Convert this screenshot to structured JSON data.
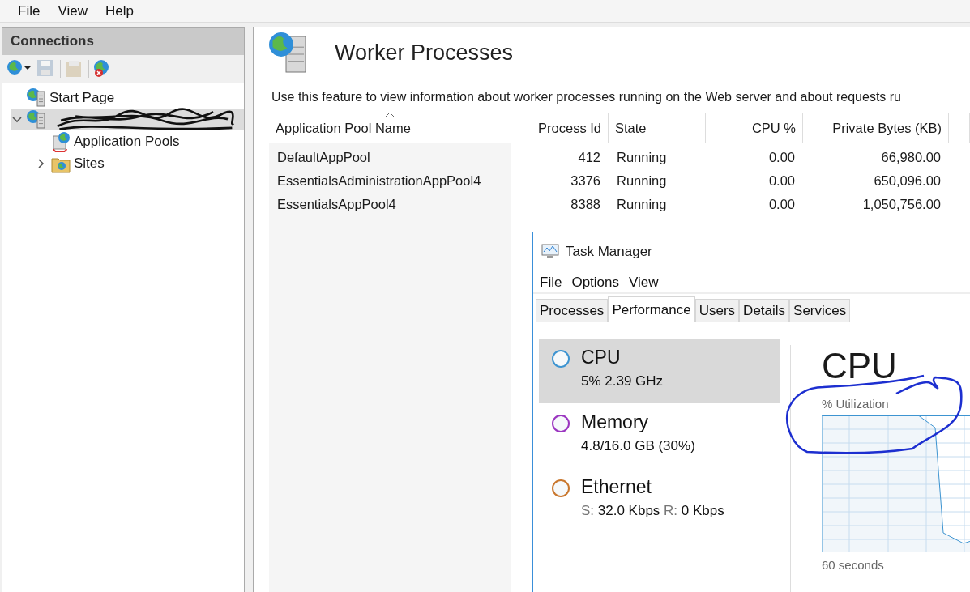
{
  "menu_bar": [
    "File",
    "View",
    "Help"
  ],
  "connections": {
    "title": "Connections",
    "toolbar": [
      {
        "disabled": false
      },
      {
        "disabled": true
      },
      {
        "disabled": true
      },
      {
        "disabled": false
      }
    ],
    "tree": [
      {
        "label": "Start Page",
        "selected": false
      },
      {
        "kind": "redacted",
        "selected": true,
        "expanded": true,
        "children": [
          {
            "label": "Application Pools",
            "selected": false
          },
          {
            "label": "Sites",
            "selected": false,
            "expanded": false
          }
        ]
      }
    ]
  },
  "feature": {
    "title": "Worker Processes",
    "description": "Use this feature to view information about worker processes running on the Web server and about requests ru",
    "table": {
      "columns": [
        {
          "label": "Application Pool Name",
          "sorted": true
        },
        {
          "label": "Process Id",
          "sorted": false
        },
        {
          "label": "State",
          "sorted": false
        },
        {
          "label": "CPU %",
          "sorted": false
        },
        {
          "label": "Private Bytes (KB)",
          "sorted": false
        }
      ],
      "rows": [
        [
          "DefaultAppPool",
          "412",
          "Running",
          "0.00",
          "66,980.00"
        ],
        [
          "EssentialsAdministrationAppPool4",
          "3376",
          "Running",
          "0.00",
          "650,096.00"
        ],
        [
          "EssentialsAppPool4",
          "8388",
          "Running",
          "0.00",
          "1,050,756.00"
        ]
      ]
    }
  },
  "task_manager": {
    "title": "Task Manager",
    "menu": [
      "File",
      "Options",
      "View"
    ],
    "tabs": [
      {
        "label": "Processes",
        "selected": false
      },
      {
        "label": "Performance",
        "selected": true
      },
      {
        "label": "Users",
        "selected": false
      },
      {
        "label": "Details",
        "selected": false
      },
      {
        "label": "Services",
        "selected": false
      }
    ],
    "resources": [
      {
        "name": "CPU",
        "selected": true,
        "color": "#3d94d1",
        "detail": [
          {
            "kind": "value",
            "text": "5%"
          },
          {
            "kind": "value",
            "text": "2.39 GHz"
          }
        ]
      },
      {
        "name": "Memory",
        "selected": false,
        "color": "#9b35c0",
        "detail": [
          {
            "kind": "value",
            "text": "4.8/16.0 GB (30%)"
          }
        ]
      },
      {
        "name": "Ethernet",
        "selected": false,
        "color": "#c9772e",
        "detail": [
          {
            "kind": "label",
            "text": "S:"
          },
          {
            "kind": "value",
            "text": "32.0 Kbps"
          },
          {
            "kind": "label",
            "text": "R:"
          },
          {
            "kind": "value",
            "text": "0 Kbps"
          }
        ]
      }
    ],
    "graph": {
      "title": "CPU",
      "axis_label": "% Utilization",
      "time_label": "60 seconds"
    }
  }
}
